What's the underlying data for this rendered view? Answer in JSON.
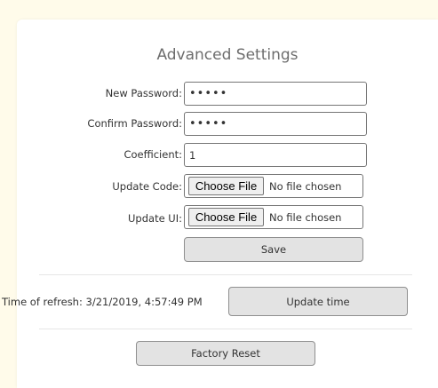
{
  "page": {
    "title": "Advanced Settings"
  },
  "form": {
    "new_password": {
      "label": "New Password:",
      "value": "•••••"
    },
    "confirm_password": {
      "label": "Confirm Password:",
      "value": "•••••"
    },
    "coefficient": {
      "label": "Coefficient:",
      "value": "1"
    },
    "update_code": {
      "label": "Update Code:",
      "button_label": "Choose File",
      "status": "No file chosen"
    },
    "update_ui": {
      "label": "Update UI:",
      "button_label": "Choose File",
      "status": "No file chosen"
    },
    "save_label": "Save"
  },
  "refresh": {
    "text": "Time of refresh: 3/21/2019, 4:57:49 PM",
    "button_label": "Update time"
  },
  "factory_reset_label": "Factory Reset",
  "colors": {
    "page_background": "#fffbea",
    "card_background": "#ffffff",
    "button_background": "#e3e3e3"
  }
}
